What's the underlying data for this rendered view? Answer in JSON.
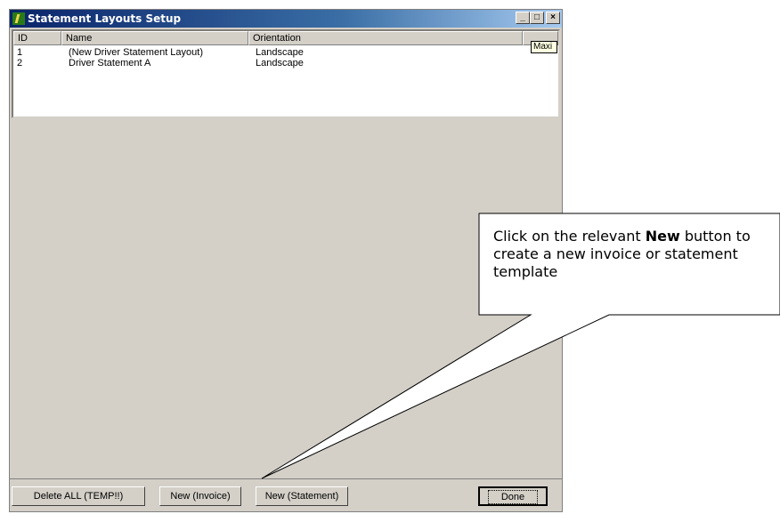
{
  "window": {
    "title": "Statement Layouts Setup"
  },
  "titlebar_buttons": {
    "minimize": "_",
    "maximize": "□",
    "close": "×"
  },
  "tooltip": "Maxi",
  "list": {
    "columns": [
      "ID",
      "Name",
      "Orientation"
    ],
    "rows": [
      {
        "id": "1",
        "name": "(New Driver Statement Layout)",
        "orientation": "Landscape"
      },
      {
        "id": "2",
        "name": "Driver Statement A",
        "orientation": "Landscape"
      }
    ]
  },
  "buttons": {
    "delete_all": "Delete ALL (TEMP!!)",
    "new_invoice": "New (Invoice)",
    "new_statement": "New (Statement)",
    "done": "Done"
  },
  "callout": {
    "prefix": "Click on the relevant ",
    "bold": "New",
    "suffix": " button to create a new invoice or statement template"
  }
}
